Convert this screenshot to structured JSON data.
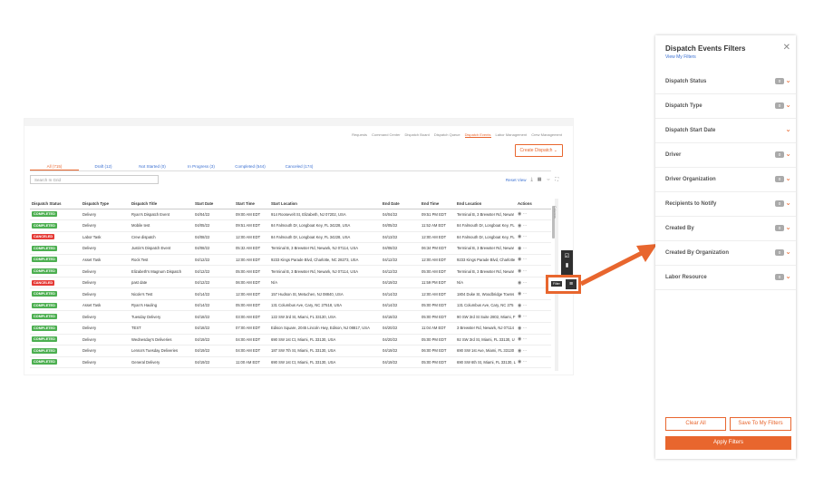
{
  "app": {
    "topnav": [
      "Requests",
      "Command Center",
      "Dispatch Board",
      "Dispatch Queue",
      "Dispatch Events",
      "Labor Management",
      "Crew Management"
    ],
    "topnav_active": 4,
    "create_button": "Create Dispatch",
    "tabs": [
      "All (715)",
      "Draft (12)",
      "Not Started (0)",
      "In Progress (3)",
      "Completed (544)",
      "Canceled (174)"
    ],
    "search_placeholder": "Search In Grid",
    "reset_view": "Reset View",
    "columns_label": "Columns",
    "headers": [
      "Dispatch Status",
      "Dispatch Type",
      "Dispatch Title",
      "Start Date",
      "Start Time",
      "Start Location",
      "End Date",
      "End Time",
      "End Location",
      "Actions"
    ],
    "rows": [
      [
        "COMPLETED",
        "Delivery",
        "Ryan's Dispatch Event",
        "04/04/22",
        "09:00 AM EDT",
        "914 Roosevelt St, Elizabeth, NJ 07202, USA",
        "04/04/22",
        "09:51 PM EDT",
        "Terminal B, 3 Brewster Rd, Newar"
      ],
      [
        "COMPLETED",
        "Delivery",
        "Mobile test",
        "04/05/22",
        "09:51 AM EDT",
        "84 Falmouth Dr, Longboat Key, FL 34228, USA",
        "04/05/22",
        "11:52 AM EDT",
        "84 Falmouth Dr, Longboat Key, FL"
      ],
      [
        "CANCELED",
        "Labor Task",
        "Crew dispatch",
        "04/08/22",
        "12:00 AM EDT",
        "84 Falmouth Dr, Longboat Key, FL 34228, USA",
        "04/13/22",
        "12:00 AM EDT",
        "84 Falmouth Dr, Longboat Key, FL"
      ],
      [
        "COMPLETED",
        "Delivery",
        "Justin's Dispatch Event",
        "04/08/22",
        "05:32 AM EDT",
        "Terminal B, 3 Brewster Rd, Newark, NJ 07114, USA",
        "04/08/22",
        "06:34 PM EDT",
        "Terminal B, 3 Brewster Rd, Newar"
      ],
      [
        "COMPLETED",
        "Asset Task",
        "Rock Test",
        "04/12/22",
        "12:00 AM EDT",
        "9233 Kings Parade Blvd, Charlotte, NC 28273, USA",
        "04/12/22",
        "12:00 AM EDT",
        "9233 Kings Parade Blvd, Charlotte"
      ],
      [
        "COMPLETED",
        "Delivery",
        "Elizabeth's Magnum Dispatch",
        "04/12/22",
        "05:00 AM EDT",
        "Terminal B, 3 Brewster Rd, Newark, NJ 07114, USA",
        "04/12/22",
        "05:00 AM EDT",
        "Terminal B, 3 Brewster Rd, Newar"
      ],
      [
        "CANCELED",
        "Delivery",
        "past date",
        "04/12/22",
        "06:00 AM EDT",
        "N/A",
        "04/19/22",
        "11:59 PM EDT",
        "N/A"
      ],
      [
        "COMPLETED",
        "Delivery",
        "Nicole's Test",
        "04/14/22",
        "12:00 AM EDT",
        "157 Hudson St, Metuchen, NJ 08840, USA",
        "04/14/22",
        "12:00 AM EDT",
        "1804 Duke St, Woodbridge Towns"
      ],
      [
        "COMPLETED",
        "Asset Task",
        "Ryan's Hauling",
        "04/14/22",
        "05:00 AM EDT",
        "131 Columbus Ave, Cary, NC 27518, USA",
        "04/14/22",
        "05:00 PM EDT",
        "131 Columbus Ave, Cary, NC 275"
      ],
      [
        "COMPLETED",
        "Delivery",
        "Tuesday Delivery",
        "04/18/22",
        "03:00 AM EDT",
        "122 SW 3rd St, Miami, FL 33130, USA",
        "04/18/22",
        "05:00 PM EDT",
        "90 SW 3rd St Suite 2802, Miami, F"
      ],
      [
        "COMPLETED",
        "Delivery",
        "TEST",
        "04/18/22",
        "07:00 AM EDT",
        "Edison Square, 2045 Lincoln Hwy, Edison, NJ 08817, USA",
        "04/20/22",
        "11:04 AM EDT",
        "3 Brewster Rd, Newark, NJ 07114"
      ],
      [
        "COMPLETED",
        "Delivery",
        "Wednesday's Deliveries",
        "04/19/22",
        "04:00 AM EDT",
        "690 SW 1st Ct, Miami, FL 33130, USA",
        "04/20/22",
        "05:00 PM EDT",
        "92 SW 3rd St, Miami, FL 33130, U"
      ],
      [
        "COMPLETED",
        "Delivery",
        "Lenna's Tuesday Deliveries",
        "04/19/22",
        "04:00 AM EDT",
        "187 SW 7th St, Miami, FL 33130, USA",
        "04/19/22",
        "06:00 PM EDT",
        "690 SW 1st Ave, Miami, FL 33130"
      ],
      [
        "COMPLETED",
        "Delivery",
        "General Delivery",
        "04/19/22",
        "11:00 AM EDT",
        "690 SW 1st Ct, Miami, FL 33130, USA",
        "04/19/22",
        "05:00 PM EDT",
        "690 SW 6th St, Miami, FL 33130, L"
      ]
    ],
    "filter_tooltip": "Filter"
  },
  "panel": {
    "title": "Dispatch Events Filters",
    "view_my_filters": "View My Filters",
    "items": [
      {
        "label": "Dispatch Status",
        "count": "0"
      },
      {
        "label": "Dispatch Type",
        "count": "0"
      },
      {
        "label": "Dispatch Start Date",
        "count": ""
      },
      {
        "label": "Driver",
        "count": "0"
      },
      {
        "label": "Driver Organization",
        "count": "0"
      },
      {
        "label": "Recipients to Notify",
        "count": "0"
      },
      {
        "label": "Created By",
        "count": "0"
      },
      {
        "label": "Created By Organization",
        "count": "0"
      },
      {
        "label": "Labor Resource",
        "count": "0"
      }
    ],
    "clear_all": "Clear All",
    "save_filters": "Save To My Filters",
    "apply": "Apply Filters"
  },
  "colors": {
    "accent": "#e8662e",
    "link": "#3a6fd1",
    "completed": "#4caf50",
    "canceled": "#e53935"
  }
}
